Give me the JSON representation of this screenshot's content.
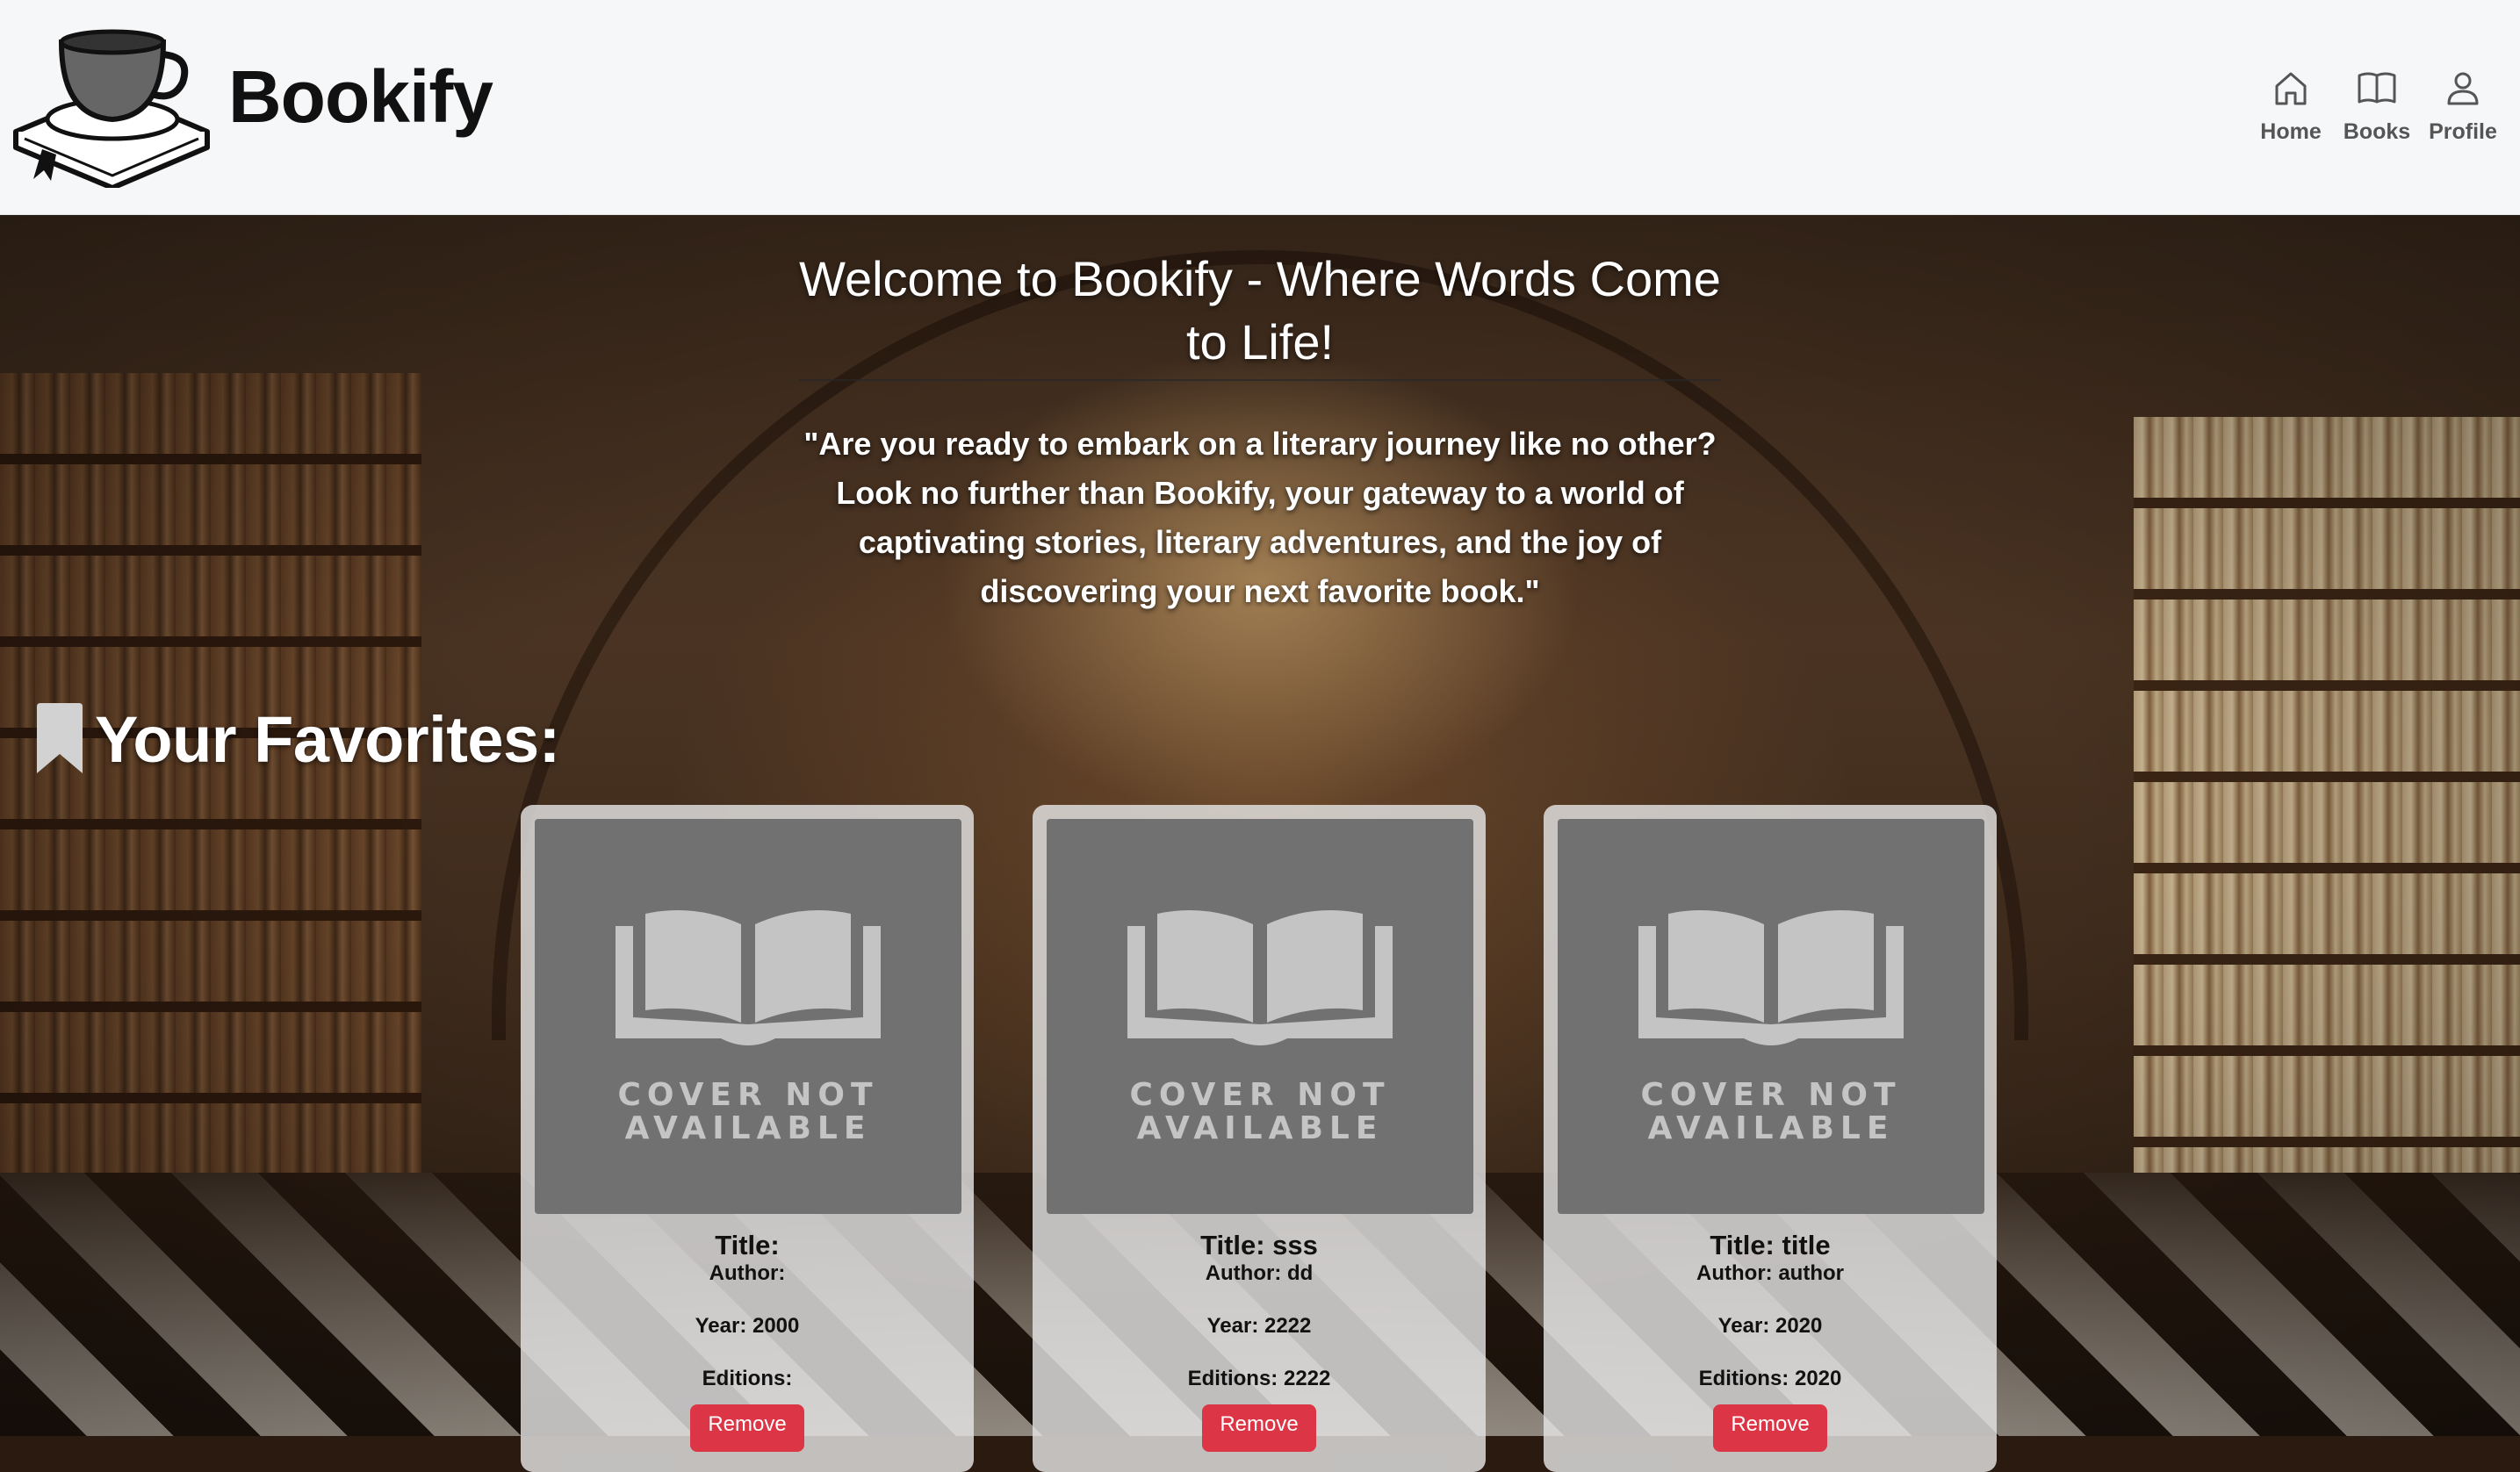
{
  "app": {
    "name": "Bookify",
    "logo_icon": "book-with-teacup-logo"
  },
  "nav": [
    {
      "label": "Home",
      "icon": "home-icon"
    },
    {
      "label": "Books",
      "icon": "open-book-icon"
    },
    {
      "label": "Profile",
      "icon": "user-icon"
    }
  ],
  "hero": {
    "welcome": "Welcome to Bookify - Where Words Come to Life!",
    "quote": "\"Are you ready to embark on a literary journey like no other? Look no further than Bookify, your gateway to a world of captivating stories, literary adventures, and the joy of discovering your next favorite book.\""
  },
  "favorites": {
    "heading": "Your Favorites:",
    "icon": "bookmark-icon",
    "cover_placeholder_line1": "COVER NOT",
    "cover_placeholder_line2": "AVAILABLE",
    "books": [
      {
        "title": "Title:",
        "author": "Author:",
        "year": "Year: 2000",
        "editions": "Editions:",
        "remove_label": "Remove"
      },
      {
        "title": "Title: sss",
        "author": "Author: dd",
        "year": "Year: 2222",
        "editions": "Editions: 2222",
        "remove_label": "Remove"
      },
      {
        "title": "Title: title",
        "author": "Author: author",
        "year": "Year: 2020",
        "editions": "Editions: 2020",
        "remove_label": "Remove"
      }
    ]
  },
  "colors": {
    "header_bg": "#f6f7f9",
    "remove_button": "#dc3545",
    "cover_placeholder": "#717171",
    "card_bg": "#e4e4e4"
  }
}
